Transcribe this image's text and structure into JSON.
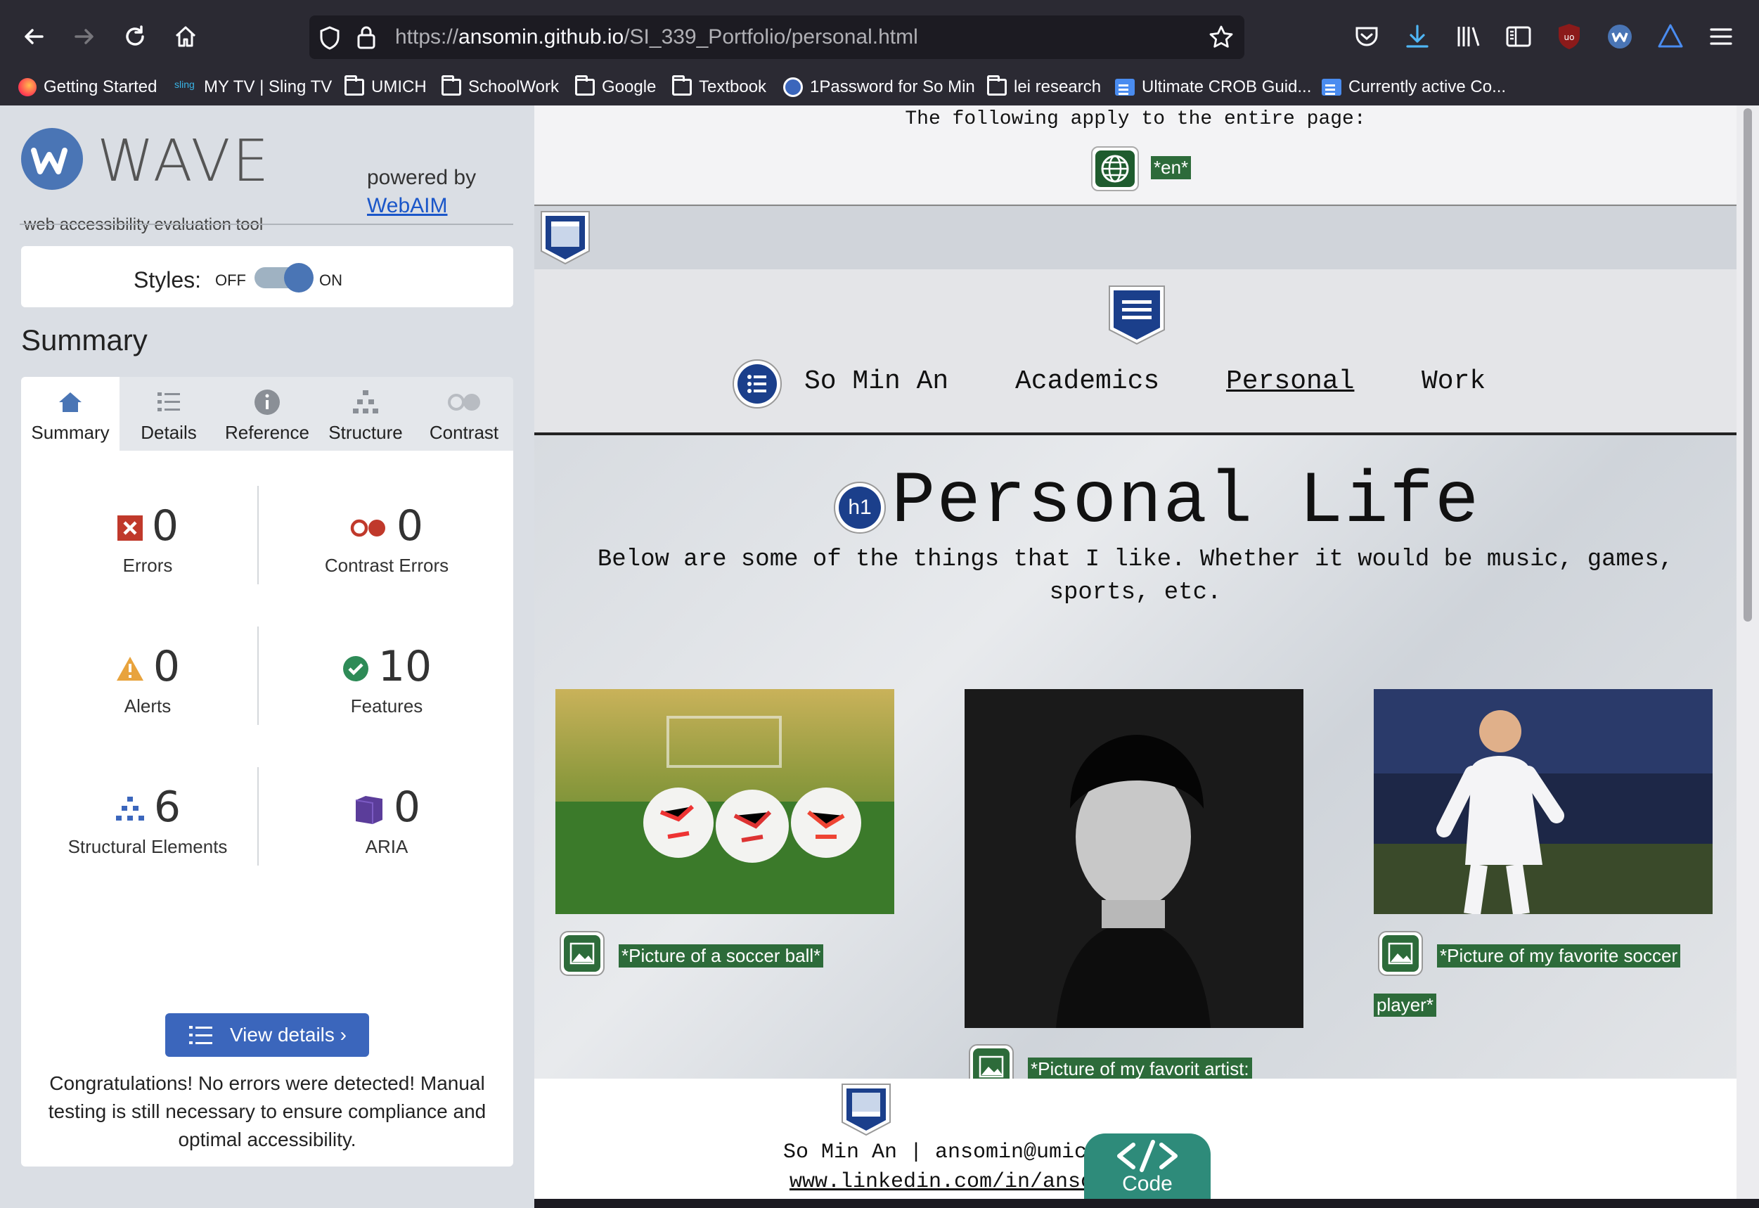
{
  "browser": {
    "url_prefix": "https://",
    "url_domain": "ansomin.github.io",
    "url_path": "/SI_339_Portfolio/personal.html",
    "bookmarks": [
      {
        "label": "Getting Started",
        "icon": "firefox-icon"
      },
      {
        "label": "MY TV | Sling TV",
        "icon": "sling-icon"
      },
      {
        "label": "UMICH",
        "icon": "folder-icon"
      },
      {
        "label": "SchoolWork",
        "icon": "folder-icon"
      },
      {
        "label": "Google",
        "icon": "folder-icon"
      },
      {
        "label": "Textbook",
        "icon": "folder-icon"
      },
      {
        "label": "1Password for So Min",
        "icon": "1password-icon"
      },
      {
        "label": "lei research",
        "icon": "folder-icon"
      },
      {
        "label": "Ultimate CROB Guid...",
        "icon": "doc-icon"
      },
      {
        "label": "Currently active Co...",
        "icon": "doc-icon"
      }
    ]
  },
  "wave": {
    "logo_text": "WAVE",
    "tagline": "web accessibility evaluation tool",
    "powered_by": "powered by",
    "webaim_link": "WebAIM",
    "styles_label": "Styles:",
    "styles_off": "OFF",
    "styles_on": "ON",
    "summary_heading": "Summary",
    "tabs": [
      {
        "label": "Summary",
        "icon": "home-icon"
      },
      {
        "label": "Details",
        "icon": "list-icon"
      },
      {
        "label": "Reference",
        "icon": "info-icon"
      },
      {
        "label": "Structure",
        "icon": "hierarchy-icon"
      },
      {
        "label": "Contrast",
        "icon": "contrast-icon"
      }
    ],
    "counts": {
      "errors": {
        "value": "0",
        "label": "Errors"
      },
      "contrast_errors": {
        "value": "0",
        "label": "Contrast Errors"
      },
      "alerts": {
        "value": "0",
        "label": "Alerts"
      },
      "features": {
        "value": "10",
        "label": "Features"
      },
      "structural": {
        "value": "6",
        "label": "Structural Elements"
      },
      "aria": {
        "value": "0",
        "label": "ARIA"
      }
    },
    "view_details": "View details ›",
    "congrats": "Congratulations! No errors were detected! Manual testing is still necessary to ensure compliance and optimal accessibility."
  },
  "page": {
    "apply_text": "The following apply to the entire page:",
    "lang_badge": "*en*",
    "nav": [
      "So Min An",
      "Academics",
      "Personal",
      "Work"
    ],
    "h1_badge": "h1",
    "title": "Personal Life",
    "intro": "Below are some of the things that I like. Whether it would be music, games, sports, etc.",
    "alt1": "*Picture of a soccer ball*",
    "alt2": "*Picture of my favorit artist:",
    "alt3_line1": "*Picture of my favorite soccer",
    "alt3_line2": "player*",
    "footer_line1": "So Min An | ansomin@umich.edu",
    "footer_line2": "www.linkedin.com/in/ansomin/",
    "code_label": "Code"
  }
}
